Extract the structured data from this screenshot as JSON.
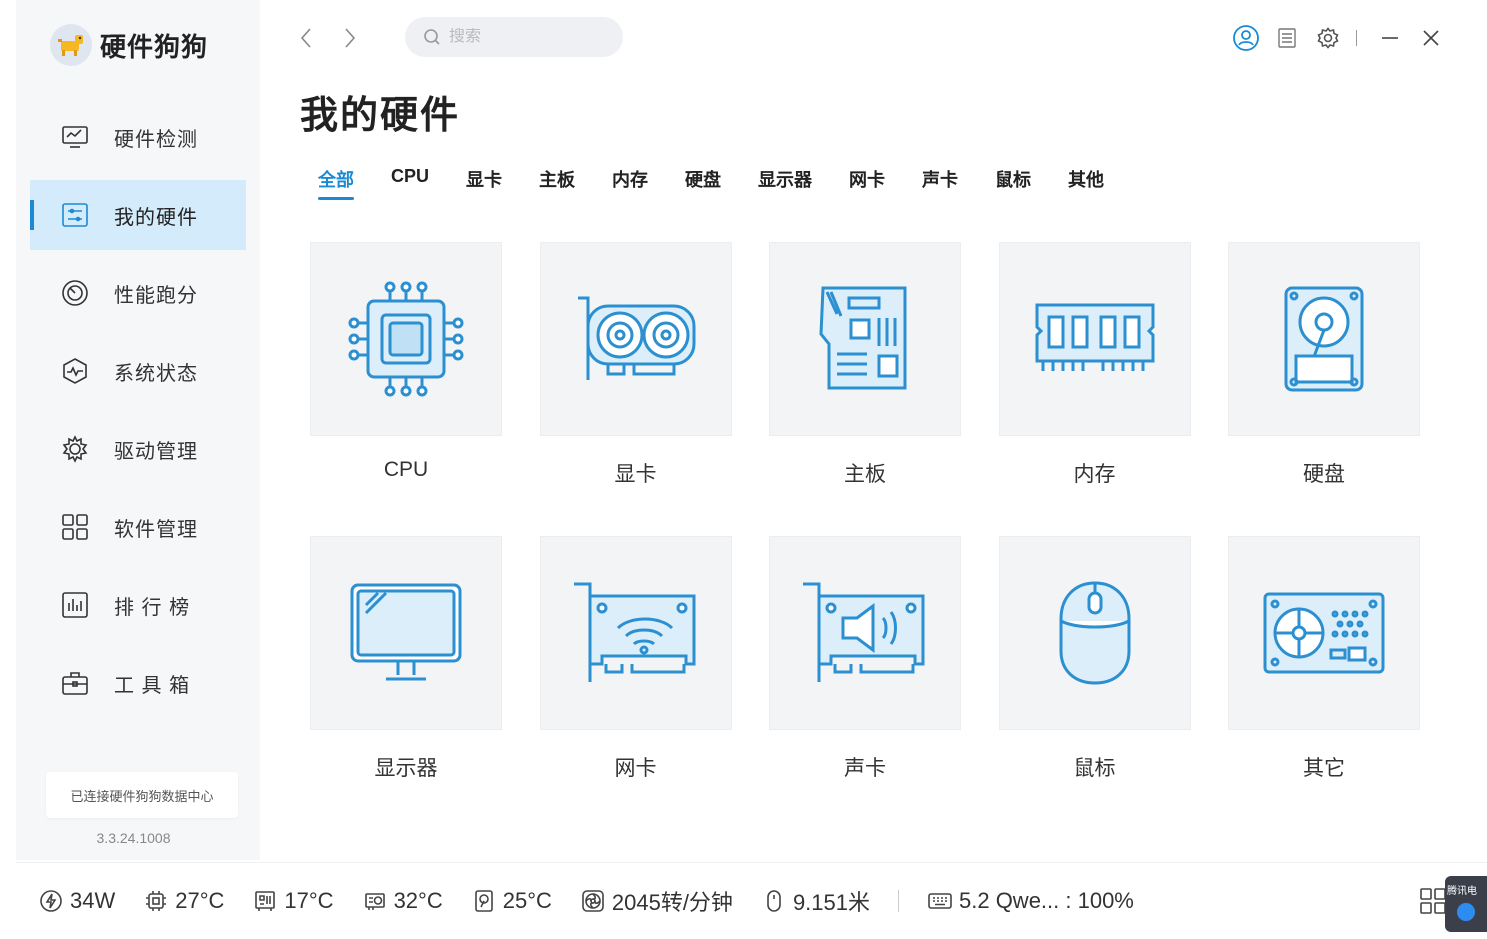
{
  "app": {
    "name": "硬件狗狗",
    "version": "3.3.24.1008",
    "connection_status": "已连接硬件狗狗数据中心"
  },
  "sidebar": {
    "items": [
      {
        "label": "硬件检测",
        "icon": "monitor-chart-icon",
        "active": false
      },
      {
        "label": "我的硬件",
        "icon": "hardware-list-icon",
        "active": true
      },
      {
        "label": "性能跑分",
        "icon": "speedometer-icon",
        "active": false
      },
      {
        "label": "系统状态",
        "icon": "heartbeat-cube-icon",
        "active": false
      },
      {
        "label": "驱动管理",
        "icon": "gear-icon",
        "active": false
      },
      {
        "label": "软件管理",
        "icon": "app-grid-icon",
        "active": false
      },
      {
        "label": "排 行 榜",
        "icon": "bar-chart-icon",
        "active": false
      },
      {
        "label": "工 具 箱",
        "icon": "toolbox-icon",
        "active": false
      }
    ]
  },
  "topbar": {
    "search_placeholder": "搜索"
  },
  "main": {
    "title": "我的硬件",
    "tabs": [
      "全部",
      "CPU",
      "显卡",
      "主板",
      "内存",
      "硬盘",
      "显示器",
      "网卡",
      "声卡",
      "鼠标",
      "其他"
    ],
    "active_tab": "全部",
    "cards": [
      {
        "label": "CPU",
        "icon": "cpu-icon"
      },
      {
        "label": "显卡",
        "icon": "graphics-card-icon"
      },
      {
        "label": "主板",
        "icon": "motherboard-icon"
      },
      {
        "label": "内存",
        "icon": "memory-icon"
      },
      {
        "label": "硬盘",
        "icon": "hard-disk-icon"
      },
      {
        "label": "显示器",
        "icon": "monitor-icon"
      },
      {
        "label": "网卡",
        "icon": "network-card-icon"
      },
      {
        "label": "声卡",
        "icon": "sound-card-icon"
      },
      {
        "label": "鼠标",
        "icon": "mouse-icon"
      },
      {
        "label": "其它",
        "icon": "other-device-icon"
      }
    ]
  },
  "statusbar": {
    "power": "34W",
    "cpu_temp": "27°C",
    "board_temp": "17°C",
    "gpu_temp": "32°C",
    "disk_temp": "25°C",
    "fan_speed": "2045转/分钟",
    "mouse_distance": "9.151米",
    "keyboard": "5.2 Qwe... : 100%"
  },
  "notification": {
    "text": "腾讯电"
  },
  "colors": {
    "accent": "#1a8ad4",
    "icon_blue": "#2b8fd0",
    "active_bg": "#d3ebfa"
  }
}
